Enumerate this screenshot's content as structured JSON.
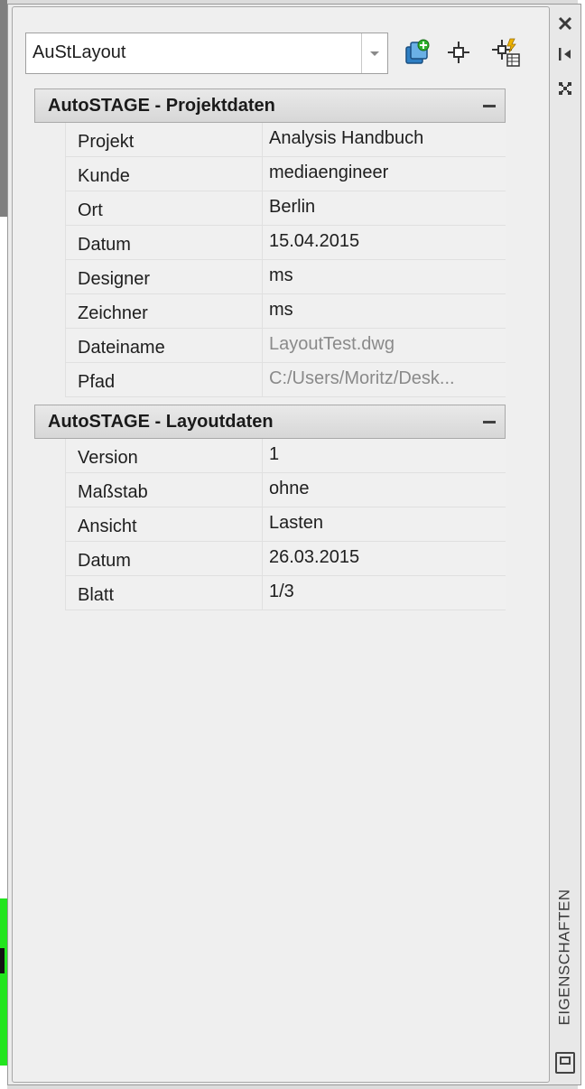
{
  "dropdown": {
    "value": "AuStLayout"
  },
  "toolbar": {
    "icons": [
      "quick-select-icon",
      "pick-objects-icon",
      "toggle-pickadd-icon"
    ]
  },
  "sidebar": {
    "icons": [
      "close-icon",
      "auto-hide-icon",
      "properties-menu-icon",
      "palette-settings-icon"
    ],
    "title": "EIGENSCHAFTEN"
  },
  "sections": [
    {
      "title": "AutoSTAGE - Projektdaten",
      "collapse": "−",
      "rows": [
        {
          "label": "Projekt",
          "value": "Analysis Handbuch",
          "readonly": false
        },
        {
          "label": "Kunde",
          "value": "mediaengineer",
          "readonly": false
        },
        {
          "label": "Ort",
          "value": "Berlin",
          "readonly": false
        },
        {
          "label": "Datum",
          "value": "15.04.2015",
          "readonly": false
        },
        {
          "label": "Designer",
          "value": "ms",
          "readonly": false
        },
        {
          "label": "Zeichner",
          "value": "ms",
          "readonly": false
        },
        {
          "label": "Dateiname",
          "value": "LayoutTest.dwg",
          "readonly": true
        },
        {
          "label": "Pfad",
          "value": "C:/Users/Moritz/Desk...",
          "readonly": true
        }
      ]
    },
    {
      "title": "AutoSTAGE - Layoutdaten",
      "collapse": "−",
      "rows": [
        {
          "label": "Version",
          "value": "1",
          "readonly": false
        },
        {
          "label": "Maßstab",
          "value": "ohne",
          "readonly": false
        },
        {
          "label": "Ansicht",
          "value": "Lasten",
          "readonly": false
        },
        {
          "label": "Datum",
          "value": "26.03.2015",
          "readonly": false
        },
        {
          "label": "Blatt",
          "value": "1/3",
          "readonly": false
        }
      ]
    }
  ]
}
